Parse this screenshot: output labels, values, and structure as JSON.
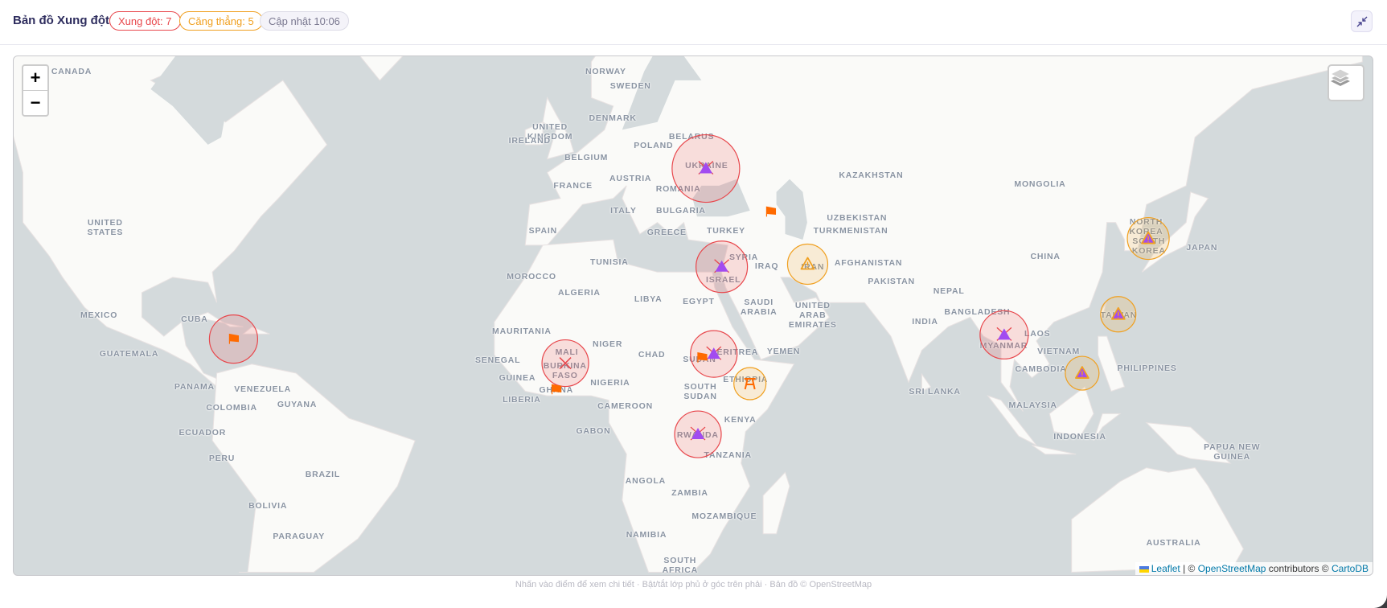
{
  "header": {
    "title": "Bản đồ Xung đột",
    "badge_conflict": "Xung đột: 7",
    "badge_tension": "Căng thẳng: 5",
    "badge_updated": "Cập nhật 10:06",
    "collapse_icon": "collapse-arrows-icon"
  },
  "colors": {
    "conflict": "#e8474c",
    "tension": "#f0a020",
    "marker_purple": "#a24bf0",
    "flag_orange": "#ff6a00",
    "land": "#fafaf8",
    "water": "#d4dadc"
  },
  "map": {
    "zoom_in": "+",
    "zoom_out": "−",
    "layers_icon": "layers-icon",
    "attribution": {
      "leaflet": "Leaflet",
      "sep": " | © ",
      "osm": "OpenStreetMap",
      "contrib": " contributors © ",
      "carto": "CartoDB"
    },
    "labels": [
      "CANADA",
      "NORWAY",
      "SWEDEN",
      "DENMARK",
      "UNITED\nKINGDOM",
      "IRELAND",
      "BELARUS",
      "POLAND",
      "BELGIUM",
      "UKRAINE",
      "KAZAKHSTAN",
      "FRANCE",
      "AUSTRIA",
      "ROMANIA",
      "MONGOLIA",
      "UNITED\nSTATES",
      "ITALY",
      "BULGARIA",
      "UZBEKISTAN",
      "SPAIN",
      "GREECE",
      "TURKEY",
      "TURKMENISTAN",
      "NORTH\nKOREA",
      "SOUTH\nKOREA",
      "JAPAN",
      "CHINA",
      "SYRIA",
      "IRAQ",
      "AFGHANISTAN",
      "IRAN",
      "TUNISIA",
      "MOROCCO",
      "ISRAEL",
      "ALGERIA",
      "LIBYA",
      "EGYPT",
      "SAUDI\nARABIA",
      "PAKISTAN",
      "NEPAL",
      "INDIA",
      "BANGLADESH",
      "UNITED\nARAB\nEMIRATES",
      "MEXICO",
      "CUBA",
      "TAIWAN",
      "MYANMAR",
      "LAOS",
      "MAURITANIA",
      "NIGER",
      "VIETNAM",
      "MALI",
      "CHAD",
      "SENEGAL",
      "GUATEMALA",
      "YEMEN",
      "SUDAN",
      "ERITREA",
      "BURKINA\nFASO",
      "CAMBODIA",
      "PHILIPPINES",
      "NIGERIA",
      "GUINEA",
      "ETHIOPIA",
      "PANAMA",
      "VENEZUELA",
      "SOUTH\nSUDAN",
      "GHANA",
      "SRI LANKA",
      "LIBERIA",
      "COLOMBIA",
      "GUYANA",
      "CAMEROON",
      "MALAYSIA",
      "KENYA",
      "GABON",
      "ECUADOR",
      "INDONESIA",
      "RWANDA",
      "PERU",
      "TANZANIA",
      "PAPUA NEW\nGUINEA",
      "BRAZIL",
      "ANGOLA",
      "ZAMBIA",
      "BOLIVIA",
      "MOZAMBIQUE",
      "NAMIBIA",
      "PARAGUAY",
      "AUSTRALIA",
      "SOUTH\nAFRICA"
    ],
    "markers": [
      {
        "type": "conflict",
        "icon": "purple-triangle-x",
        "lat": 48.6,
        "lon": 31.0
      },
      {
        "type": "conflict",
        "icon": "purple-triangle-x",
        "lat": 32.0,
        "lon": 34.6
      },
      {
        "type": "conflict",
        "icon": "orange-flag",
        "lat": 17.4,
        "lon": -76.2
      },
      {
        "type": "conflict",
        "icon": "red-x",
        "lat": 12.2,
        "lon": -0.9
      },
      {
        "type": "conflict",
        "icon": "purple-triangle-x",
        "lat": 14.2,
        "lon": 32.8
      },
      {
        "type": "conflict",
        "icon": "purple-triangle-x",
        "lat": -3.6,
        "lon": 29.2
      },
      {
        "type": "conflict",
        "icon": "purple-triangle-x",
        "lat": 18.3,
        "lon": 98.7
      },
      {
        "type": "tension",
        "icon": "warning-triangle",
        "lat": 32.5,
        "lon": 54.1
      },
      {
        "type": "tension",
        "icon": "orange-tower",
        "lat": 7.7,
        "lon": 41.0
      },
      {
        "type": "tension",
        "icon": "warning-triangle-purple",
        "lat": 37.2,
        "lon": 131.4
      },
      {
        "type": "tension",
        "icon": "warning-triangle-purple",
        "lat": 22.6,
        "lon": 124.6
      },
      {
        "type": "tension",
        "icon": "warning-triangle-purple",
        "lat": 10.0,
        "lon": 116.4
      }
    ],
    "flags": [
      {
        "icon": "orange-flag",
        "lat": 41.8,
        "lon": 45.7
      },
      {
        "icon": "orange-flag",
        "lat": 6.4,
        "lon": -3.0
      },
      {
        "icon": "orange-flag",
        "lat": 13.4,
        "lon": 30.1
      }
    ]
  },
  "footer": "Nhấn vào điểm để xem chi tiết · Bật/tắt lớp phủ ở góc trên phải · Bản đồ © OpenStreetMap"
}
